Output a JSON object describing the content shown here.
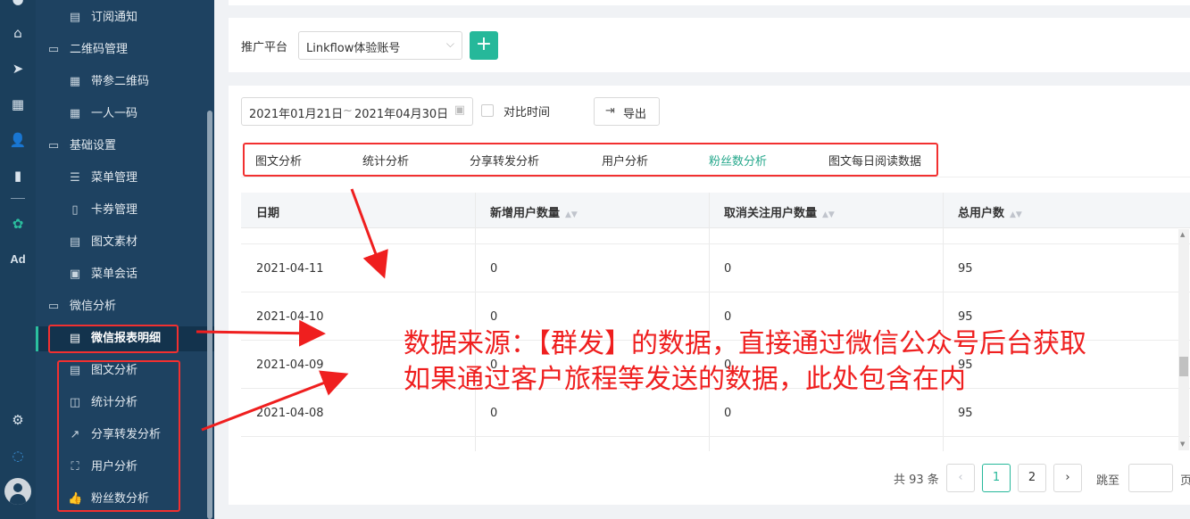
{
  "rail": {
    "items": [
      "home-icon",
      "send-icon",
      "layout-icon",
      "user-icon",
      "bar-chart-icon",
      "wechat-icon",
      "Ad",
      "gear-icon",
      "chat-bubble-icon",
      "avatar"
    ]
  },
  "sidebar": {
    "items": [
      {
        "label": "订阅通知",
        "icon": "bell-icon",
        "level": "sub"
      },
      {
        "label": "二维码管理",
        "icon": "folder-icon",
        "level": "group"
      },
      {
        "label": "带参二维码",
        "icon": "qrcode-icon",
        "level": "sub"
      },
      {
        "label": "一人一码",
        "icon": "qrcode-icon",
        "level": "sub"
      },
      {
        "label": "基础设置",
        "icon": "folder-icon",
        "level": "group"
      },
      {
        "label": "菜单管理",
        "icon": "list-icon",
        "level": "sub"
      },
      {
        "label": "卡券管理",
        "icon": "coupon-icon",
        "level": "sub"
      },
      {
        "label": "图文素材",
        "icon": "document-icon",
        "level": "sub"
      },
      {
        "label": "菜单会话",
        "icon": "chat-icon",
        "level": "sub"
      },
      {
        "label": "微信分析",
        "icon": "folder-icon",
        "level": "group"
      },
      {
        "label": "微信报表明细",
        "icon": "report-icon",
        "level": "sub",
        "active": true
      },
      {
        "label": "图文分析",
        "icon": "document-icon",
        "level": "sub"
      },
      {
        "label": "统计分析",
        "icon": "stats-icon",
        "level": "sub"
      },
      {
        "label": "分享转发分析",
        "icon": "share-icon",
        "level": "sub"
      },
      {
        "label": "用户分析",
        "icon": "user-scan-icon",
        "level": "sub"
      },
      {
        "label": "粉丝数分析",
        "icon": "thumbs-up-icon",
        "level": "sub"
      }
    ]
  },
  "platform": {
    "label": "推广平台",
    "selected": "Linkflow体验账号",
    "add_label": "+"
  },
  "filters": {
    "date_start": "2021年01月21日",
    "date_sep": "~",
    "date_end": "2021年04月30日",
    "compare_label": "对比时间",
    "export_label": "导出"
  },
  "tabs": [
    {
      "label": "图文分析"
    },
    {
      "label": "统计分析"
    },
    {
      "label": "分享转发分析"
    },
    {
      "label": "用户分析"
    },
    {
      "label": "粉丝数分析",
      "active": true
    },
    {
      "label": "图文每日阅读数据"
    }
  ],
  "table": {
    "columns": [
      "日期",
      "新增用户数量",
      "取消关注用户数量",
      "总用户数"
    ],
    "rows": [
      [
        "2021-04-11",
        "0",
        "0",
        "95"
      ],
      [
        "2021-04-10",
        "0",
        "0",
        "95"
      ],
      [
        "2021-04-09",
        "0",
        "0",
        "95"
      ],
      [
        "2021-04-08",
        "0",
        "0",
        "95"
      ]
    ]
  },
  "pagination": {
    "total": "共 93 条",
    "pages": [
      "1",
      "2"
    ],
    "current": "1",
    "jump_label": "跳至",
    "jump_suffix": "页"
  },
  "annotation": {
    "line1": "数据来源：【群发】的数据，直接通过微信公众号后台获取",
    "line2": "如果通过客户旅程等发送的数据，此处包含在内",
    "color": "#ef1f1f"
  },
  "colors": {
    "rail_bg": "#1b3f5c",
    "sidebar_bg": "#1e4261",
    "accent": "#26b89a",
    "annotation_red": "#ef1f1f"
  }
}
